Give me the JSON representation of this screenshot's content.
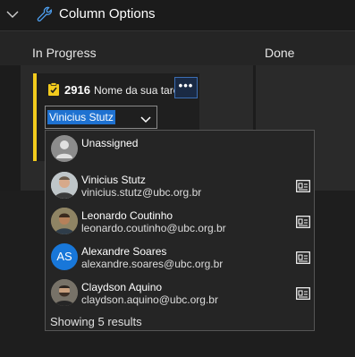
{
  "toolbar": {
    "title": "Column Options",
    "icons": [
      "chevron-down-icon",
      "wrench-icon"
    ]
  },
  "board": {
    "columns": [
      "In Progress",
      "Done"
    ],
    "card": {
      "id": "2916",
      "title": "Nome da sua tarefa",
      "accent_color": "#f2cb1d",
      "more_label": "•••",
      "assignee_value": "Vinicius Stutz"
    }
  },
  "people_picker": {
    "unassigned_label": "Unassigned",
    "people": [
      {
        "name": "Vinicius Stutz",
        "email": "vinicius.stutz@ubc.org.br"
      },
      {
        "name": "Leonardo Coutinho",
        "email": "leonardo.coutinho@ubc.org.br"
      },
      {
        "name": "Alexandre Soares",
        "email": "alexandre.soares@ubc.org.br",
        "initials": "AS"
      },
      {
        "name": "Claydson Aquino",
        "email": "claydson.aquino@ubc.org.br"
      }
    ],
    "footer": "Showing 5 results"
  }
}
